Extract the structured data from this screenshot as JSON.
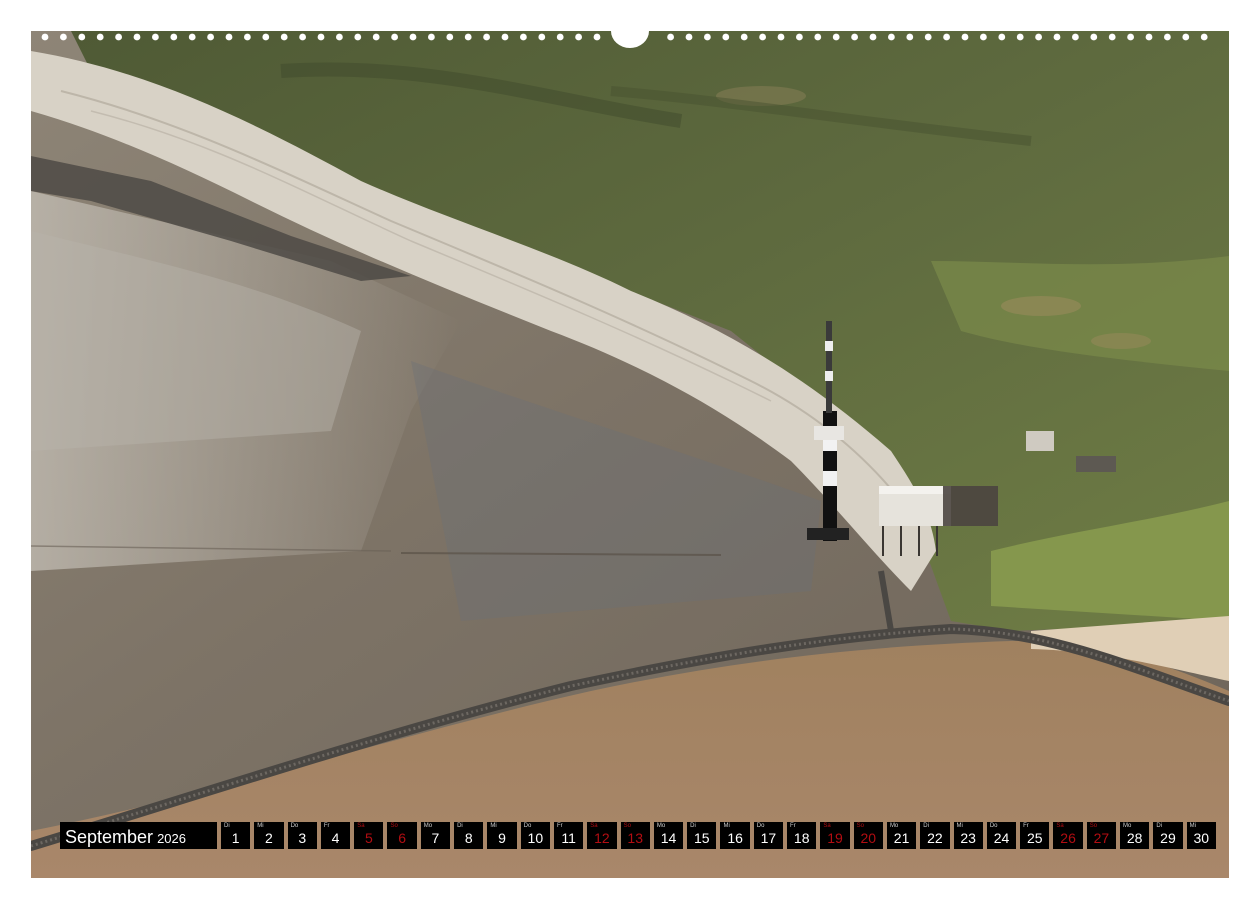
{
  "calendar": {
    "month": "September",
    "year": "2026",
    "days": [
      {
        "n": "1",
        "wd": "Di",
        "weekend": false
      },
      {
        "n": "2",
        "wd": "Mi",
        "weekend": false
      },
      {
        "n": "3",
        "wd": "Do",
        "weekend": false
      },
      {
        "n": "4",
        "wd": "Fr",
        "weekend": false
      },
      {
        "n": "5",
        "wd": "Sa",
        "weekend": true
      },
      {
        "n": "6",
        "wd": "So",
        "weekend": true
      },
      {
        "n": "7",
        "wd": "Mo",
        "weekend": false
      },
      {
        "n": "8",
        "wd": "Di",
        "weekend": false
      },
      {
        "n": "9",
        "wd": "Mi",
        "weekend": false
      },
      {
        "n": "10",
        "wd": "Do",
        "weekend": false
      },
      {
        "n": "11",
        "wd": "Fr",
        "weekend": false
      },
      {
        "n": "12",
        "wd": "Sa",
        "weekend": true
      },
      {
        "n": "13",
        "wd": "So",
        "weekend": true
      },
      {
        "n": "14",
        "wd": "Mo",
        "weekend": false
      },
      {
        "n": "15",
        "wd": "Di",
        "weekend": false
      },
      {
        "n": "16",
        "wd": "Mi",
        "weekend": false
      },
      {
        "n": "17",
        "wd": "Do",
        "weekend": false
      },
      {
        "n": "18",
        "wd": "Fr",
        "weekend": false
      },
      {
        "n": "19",
        "wd": "Sa",
        "weekend": true
      },
      {
        "n": "20",
        "wd": "So",
        "weekend": true
      },
      {
        "n": "21",
        "wd": "Mo",
        "weekend": false
      },
      {
        "n": "22",
        "wd": "Di",
        "weekend": false
      },
      {
        "n": "23",
        "wd": "Mi",
        "weekend": false
      },
      {
        "n": "24",
        "wd": "Do",
        "weekend": false
      },
      {
        "n": "25",
        "wd": "Fr",
        "weekend": false
      },
      {
        "n": "26",
        "wd": "Sa",
        "weekend": true
      },
      {
        "n": "27",
        "wd": "So",
        "weekend": true
      },
      {
        "n": "28",
        "wd": "Mo",
        "weekend": false
      },
      {
        "n": "29",
        "wd": "Di",
        "weekend": false
      },
      {
        "n": "30",
        "wd": "Mi",
        "weekend": false
      }
    ]
  },
  "photo": {
    "subject": "aerial-coast-lighthouse",
    "colors": {
      "vegetation": "#5f6b3f",
      "vegetation_light": "#7f8f4f",
      "beach": "#d8d2c6",
      "mudflat": "#857a6d",
      "wet_sand": "#a88564",
      "groyne": "#4a4743",
      "tower_dark": "#111111",
      "tower_light": "#f2f2f2"
    }
  },
  "colors": {
    "weekend_red": "#b30d12",
    "calendar_bg": "#000000",
    "page_bg": "#ffffff"
  }
}
